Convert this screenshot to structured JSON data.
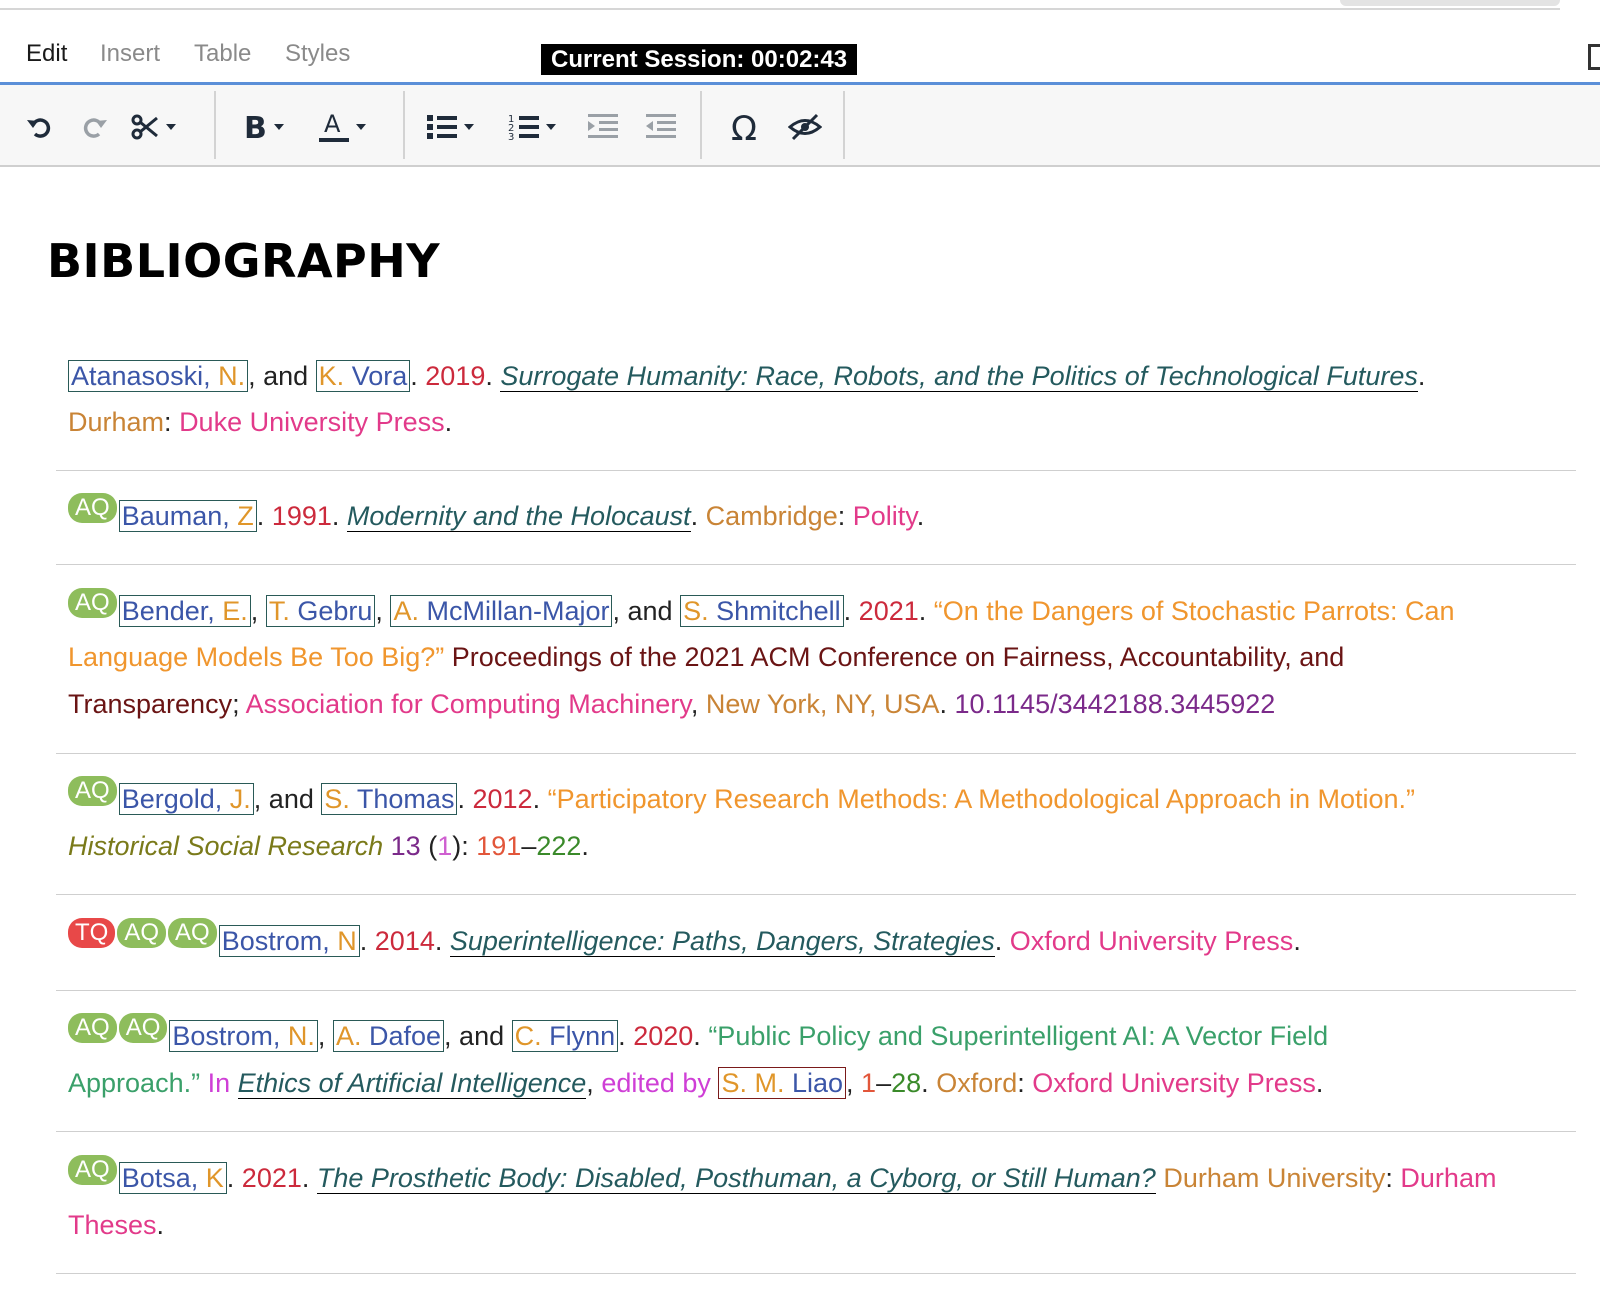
{
  "menu": {
    "items": [
      "Edit",
      "Insert",
      "Table",
      "Styles"
    ],
    "active": "Edit"
  },
  "session": {
    "label": "Current Session: 00:02:43"
  },
  "toolbar": {
    "icons": [
      "undo-icon",
      "redo-icon",
      "cut-icon",
      "bold-icon",
      "font-color-icon",
      "bullet-list-icon",
      "numbered-list-icon",
      "indent-icon",
      "outdent-icon",
      "omega-icon",
      "hide-icon"
    ]
  },
  "document": {
    "heading": "BIBLIOGRAPHY",
    "entries": [
      {
        "badges": [],
        "line1": {
          "a1_last": "Atanasoski,",
          "a1_first": "N.",
          "sep1": ", and",
          "a2_first": "K.",
          "a2_last": "Vora",
          "sep2": ".",
          "year": "2019",
          "sep3": ".",
          "title": "Surrogate Humanity: Race, Robots, and the Politics of Technological Futures",
          "sep4": "."
        },
        "line2": {
          "place": "Durham",
          "sep1": ":",
          "publisher": "Duke University Press",
          "sep2": "."
        }
      },
      {
        "badges": [
          "AQ"
        ],
        "line1": {
          "a1_last": "Bauman,",
          "a1_first": "Z",
          "sep1": ".",
          "year": "1991",
          "sep2": ".",
          "title": "Modernity and the Holocaust",
          "sep3": ".",
          "place": "Cambridge",
          "sep4": ":",
          "publisher": "Polity",
          "sep5": "."
        }
      },
      {
        "badges": [
          "AQ"
        ],
        "line1": {
          "a1_last": "Bender,",
          "a1_first": "E.",
          "sep1": ",",
          "a2_first": "T.",
          "a2_last": "Gebru",
          "sep2": ",",
          "a3_first": "A.",
          "a3_last": "McMillan-Major",
          "sep3": ", and",
          "a4_first": "S.",
          "a4_last": "Shmitchell",
          "sep4": ".",
          "year": "2021",
          "sep5": ".",
          "article_part": "“On the Dangers of Stochastic Parrots: Can"
        },
        "line2": {
          "article_part": "Language Models Be Too Big?”",
          "proceedings_part": "Proceedings of the 2021 ACM Conference on Fairness, Accountability, and"
        },
        "line3": {
          "proceedings_part": "Transparency",
          "sep1": ";",
          "publisher": "Association for Computing Machinery",
          "sep2": ",",
          "place": "New York, NY, USA",
          "sep3": ".",
          "doi": "10.1145/3442188.3445922"
        }
      },
      {
        "badges": [
          "AQ"
        ],
        "line1": {
          "a1_last": "Bergold,",
          "a1_first": "J.",
          "sep1": ", and",
          "a2_first": "S.",
          "a2_last": "Thomas",
          "sep2": ".",
          "year": "2012",
          "sep3": ".",
          "article": "“Participatory Research Methods: A Methodological Approach in Motion.”"
        },
        "line2": {
          "journal": "Historical Social Research",
          "volume": "13",
          "open": "(",
          "issue": "1",
          "close": "):",
          "page_start": "191",
          "dash": "–",
          "page_end": "222",
          "end": "."
        }
      },
      {
        "badges": [
          "TQ",
          "AQ",
          "AQ"
        ],
        "line1": {
          "a1_last": "Bostrom,",
          "a1_first": "N",
          "sep1": ".",
          "year": "2014",
          "sep2": ".",
          "title": "Superintelligence: Paths, Dangers, Strategies",
          "sep3": ".",
          "publisher": "Oxford University Press",
          "sep4": "."
        }
      },
      {
        "badges": [
          "AQ",
          "AQ"
        ],
        "line1": {
          "a1_last": "Bostrom,",
          "a1_first": "N.",
          "sep1": ",",
          "a2_first": "A.",
          "a2_last": "Dafoe",
          "sep2": ", and",
          "a3_first": "C.",
          "a3_last": "Flynn",
          "sep3": ".",
          "year": "2020",
          "sep4": ".",
          "chapter_part": "“Public Policy and Superintelligent AI: A Vector Field"
        },
        "line2": {
          "chapter_part": "Approach.”",
          "in": "In",
          "book": "Ethics of Artificial Intelligence",
          "sep1": ",",
          "edited_by": "edited by",
          "ed_first": "S. M.",
          "ed_last": "Liao",
          "sep2": ",",
          "page_start": "1",
          "dash": "–",
          "page_end": "28",
          "sep3": ".",
          "place": "Oxford",
          "sep4": ":",
          "publisher": "Oxford University Press",
          "sep5": "."
        }
      },
      {
        "badges": [
          "AQ"
        ],
        "line1": {
          "a1_last": "Botsa,",
          "a1_first": "K",
          "sep1": ".",
          "year": "2021",
          "sep2": ".",
          "title": "The Prosthetic Body: Disabled, Posthuman, a Cyborg, or Still Human?",
          "institution": "Durham University",
          "sep3": ":",
          "publisher_part": "Durham"
        },
        "line2": {
          "publisher_part": "Theses",
          "sep1": "."
        }
      }
    ]
  }
}
